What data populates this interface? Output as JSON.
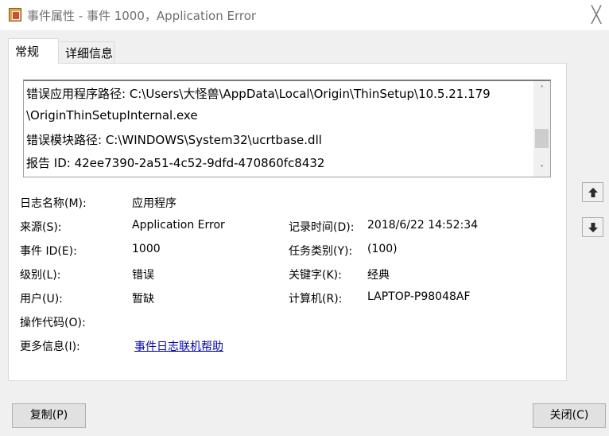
{
  "window": {
    "title": "事件属性 - 事件 1000，Application Error",
    "close_glyph": "╳"
  },
  "tabs": [
    {
      "label": "常规",
      "active": true
    },
    {
      "label": "详细信息",
      "active": false
    }
  ],
  "description": {
    "lines": [
      "错误应用程序路径: C:\\Users\\大怪兽\\AppData\\Local\\Origin\\ThinSetup\\10.5.21.179",
      "\\OriginThinSetupInternal.exe",
      "错误模块路径: C:\\WINDOWS\\System32\\ucrtbase.dll",
      "报告 ID: 42ee7390-2a51-4c52-9dfd-470860fc8432"
    ],
    "scroll_up_glyph": "˄",
    "scroll_down_glyph": "˅"
  },
  "fields": {
    "log_name": {
      "label": "日志名称(M):",
      "value": "应用程序"
    },
    "source": {
      "label": "来源(S):",
      "value": "Application Error"
    },
    "logged": {
      "label": "记录时间(D):",
      "value": "2018/6/22 14:52:34"
    },
    "event_id": {
      "label": "事件 ID(E):",
      "value": "1000"
    },
    "task_category": {
      "label": "任务类别(Y):",
      "value": "(100)"
    },
    "level": {
      "label": "级别(L):",
      "value": "错误"
    },
    "keywords": {
      "label": "关键字(K):",
      "value": "经典"
    },
    "user": {
      "label": "用户(U):",
      "value": "暂缺"
    },
    "computer": {
      "label": "计算机(R):",
      "value": "LAPTOP-P98048AF"
    },
    "opcode": {
      "label": "操作代码(O):",
      "value": ""
    },
    "more_info": {
      "label": "更多信息(I):",
      "value": "事件日志联机帮助"
    }
  },
  "buttons": {
    "copy": "复制(P)",
    "close": "关闭(C)",
    "prev_icon": "up-arrow-icon",
    "next_icon": "down-arrow-icon"
  }
}
